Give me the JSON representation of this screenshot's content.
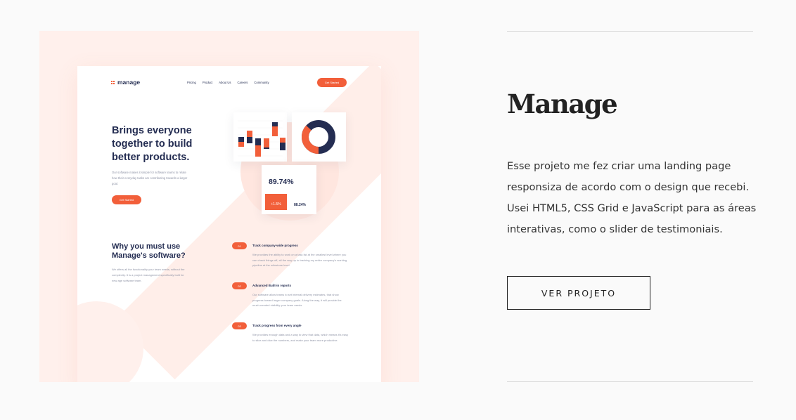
{
  "preview": {
    "brand": "manage",
    "nav": [
      "Pricing",
      "Product",
      "About Us",
      "Careers",
      "Community"
    ],
    "nav_cta": "Get Started",
    "hero_title": "Brings everyone together to build better products.",
    "hero_text": "Our software makes it simple for software teams to relate how their everyday tasks are contributing towards a larger goal.",
    "hero_button": "Get Started",
    "stat_main": "89.74%",
    "stat_badge": "+1.5%",
    "stat_side": "88.24%",
    "why_title": "Why you must use Manage's software?",
    "why_text": "We offers all the functionality your team needs, without the complexity. It is a project management specifically built for new age software team.",
    "features": [
      {
        "number": "01",
        "title": "Track company-wide progress",
        "text": "We provides the ability to work on a task list at the smallest level where you can check things off, all the way up to tracking my entire company's working pipeline at the milestone level."
      },
      {
        "number": "02",
        "title": "Advanced Built-in reports",
        "text": "Our software allow teams to set internal delivery estimates, that show progress toward larger company goals. Along the way, it will provide the much-needed visibility your team needs."
      },
      {
        "number": "03",
        "title": "Track progress from every angle",
        "text": "We provides enough data and a way to view that data, which means it's easy to slice and dice the numbers, and make your team more productive."
      }
    ],
    "colors": {
      "accent": "#f25f3a",
      "navy": "#242d52",
      "panel_bg": "#fff0ec"
    }
  },
  "project": {
    "title": "Manage",
    "description": "Esse projeto me fez criar uma landing page responsiza de acordo com o design que recebi. Usei HTML5, CSS Grid e JavaScript para as áreas interativas, como o slider de testimoniais.",
    "button_label": "VER PROJETO"
  }
}
